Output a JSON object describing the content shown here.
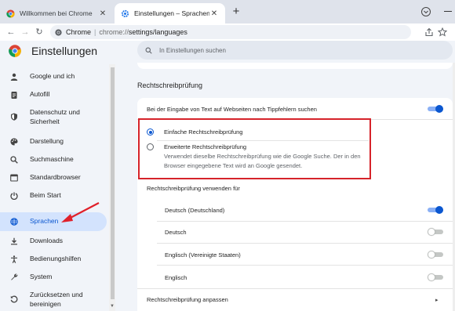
{
  "tabs": [
    {
      "title": "Willkommen bei Chrome",
      "active": false
    },
    {
      "title": "Einstellungen – Sprachen",
      "active": true
    }
  ],
  "omnibox": {
    "site_label": "Chrome",
    "url_host": "chrome://",
    "url_path": "settings/languages"
  },
  "header": {
    "title": "Einstellungen",
    "search_placeholder": "In Einstellungen suchen"
  },
  "sidebar": {
    "items": [
      {
        "label": "Google und ich",
        "icon": "person-icon"
      },
      {
        "label": "Autofill",
        "icon": "clipboard-icon"
      },
      {
        "label": "Datenschutz und Sicherheit",
        "icon": "shield-icon"
      },
      {
        "label": "Darstellung",
        "icon": "palette-icon"
      },
      {
        "label": "Suchmaschine",
        "icon": "search-icon"
      },
      {
        "label": "Standardbrowser",
        "icon": "browser-icon"
      },
      {
        "label": "Beim Start",
        "icon": "power-icon"
      },
      {
        "label": "Sprachen",
        "icon": "globe-icon",
        "active": true
      },
      {
        "label": "Downloads",
        "icon": "download-icon"
      },
      {
        "label": "Bedienungshilfen",
        "icon": "accessibility-icon"
      },
      {
        "label": "System",
        "icon": "wrench-icon"
      },
      {
        "label": "Zurücksetzen und bereinigen",
        "icon": "reset-icon"
      }
    ]
  },
  "main": {
    "section_title": "Rechtschreibprüfung",
    "spellcheck_toggle_label": "Bei der Eingabe von Text auf Webseiten nach Tippfehlern suchen",
    "spellcheck_on": true,
    "options": [
      {
        "label": "Einfache Rechtschreibprüfung",
        "checked": true
      },
      {
        "label": "Erweiterte Rechtschreibprüfung",
        "checked": false,
        "description": "Verwendet dieselbe Rechtschreibprüfung wie die Google Suche. Der in den Browser eingegebene Text wird an Google gesendet."
      }
    ],
    "languages_heading": "Rechtschreibprüfung verwenden für",
    "languages": [
      {
        "label": "Deutsch (Deutschland)",
        "on": true
      },
      {
        "label": "Deutsch",
        "on": false
      },
      {
        "label": "Englisch (Vereinigte Staaten)",
        "on": false
      },
      {
        "label": "Englisch",
        "on": false
      }
    ],
    "customize_label": "Rechtschreibprüfung anpassen"
  },
  "colors": {
    "accent": "#0b57d0",
    "highlight_box": "#d6232a",
    "active_nav_bg": "#d3e3fd"
  }
}
